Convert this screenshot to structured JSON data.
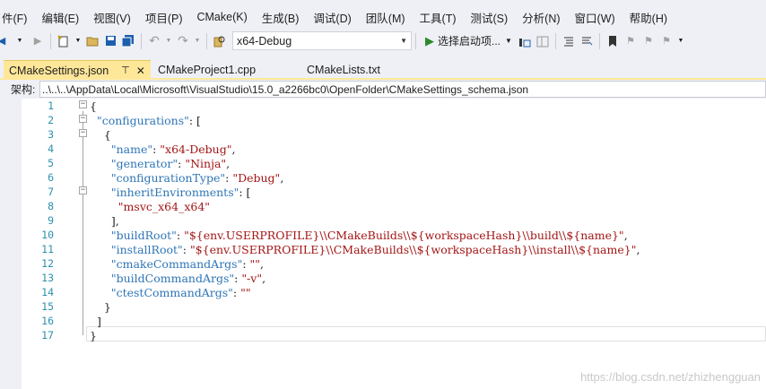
{
  "menu": [
    "件(F)",
    "编辑(E)",
    "视图(V)",
    "项目(P)",
    "CMake(K)",
    "生成(B)",
    "调试(D)",
    "团队(M)",
    "工具(T)",
    "测试(S)",
    "分析(N)",
    "窗口(W)",
    "帮助(H)"
  ],
  "toolbar": {
    "config_value": "x64-Debug",
    "start_label": "选择启动项..."
  },
  "tabs": [
    {
      "label": "CMakeSettings.json",
      "active": true
    },
    {
      "label": "CMakeProject1.cpp",
      "active": false
    },
    {
      "label": "CMakeLists.txt",
      "active": false
    }
  ],
  "schema": {
    "label": "架构:",
    "path": "..\\..\\..\\AppData\\Local\\Microsoft\\VisualStudio\\15.0_a2266bc0\\OpenFolder\\CMakeSettings_schema.json"
  },
  "editor": {
    "line_numbers": [
      "1",
      "2",
      "3",
      "4",
      "5",
      "6",
      "7",
      "8",
      "9",
      "10",
      "11",
      "12",
      "13",
      "14",
      "15",
      "16",
      "17"
    ],
    "lines": [
      "{",
      "  \"configurations\": [",
      "    {",
      "      \"name\": \"x64-Debug\",",
      "      \"generator\": \"Ninja\",",
      "      \"configurationType\": \"Debug\",",
      "      \"inheritEnvironments\": [",
      "        \"msvc_x64_x64\"",
      "      ],",
      "      \"buildRoot\": \"${env.USERPROFILE}\\\\CMakeBuilds\\\\${workspaceHash}\\\\build\\\\${name}\",",
      "      \"installRoot\": \"${env.USERPROFILE}\\\\CMakeBuilds\\\\${workspaceHash}\\\\install\\\\${name}\",",
      "      \"cmakeCommandArgs\": \"\",",
      "      \"buildCommandArgs\": \"-v\",",
      "      \"ctestCommandArgs\": \"\"",
      "    }",
      "  ]",
      "}"
    ]
  },
  "watermark": "https://blog.csdn.net/zhizhengguan",
  "colors": {
    "key": "#2e75b6",
    "string": "#a31515",
    "tab_active": "#ffe79a",
    "line_number": "#2b91af"
  }
}
